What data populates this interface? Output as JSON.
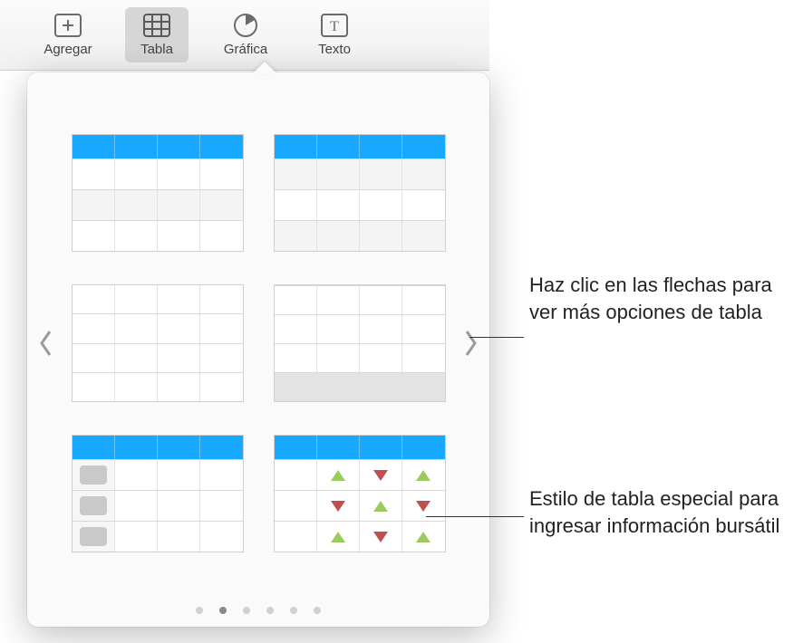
{
  "toolbar": {
    "items": [
      {
        "label": "Agregar",
        "icon": "add-icon"
      },
      {
        "label": "Tabla",
        "icon": "table-icon",
        "selected": true
      },
      {
        "label": "Gráfica",
        "icon": "chart-icon"
      },
      {
        "label": "Texto",
        "icon": "text-icon"
      }
    ]
  },
  "popover": {
    "pages_count": 6,
    "active_page_index": 1,
    "styles": [
      {
        "name": "table-style-header-alt-1"
      },
      {
        "name": "table-style-header-alt-2"
      },
      {
        "name": "table-style-plain"
      },
      {
        "name": "table-style-footer"
      },
      {
        "name": "table-style-row-headers"
      },
      {
        "name": "table-style-stock"
      }
    ]
  },
  "callouts": {
    "arrows": "Haz clic en las flechas para ver más opciones de tabla",
    "stock": "Estilo de tabla especial para ingresar información bursátil"
  },
  "colors": {
    "accent": "#18a8ff"
  }
}
